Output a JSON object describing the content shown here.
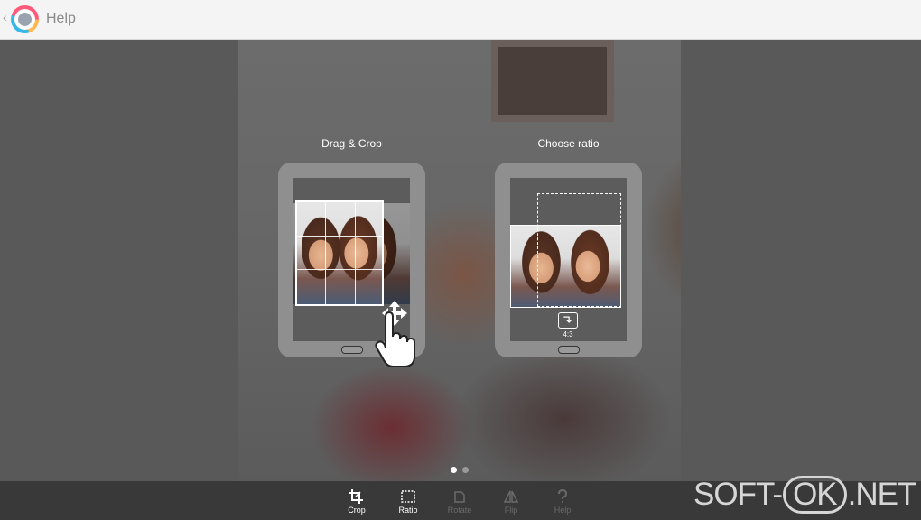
{
  "header": {
    "back_glyph": "‹",
    "title": "Help"
  },
  "slides": [
    {
      "label": "Drag & Crop"
    },
    {
      "label": "Choose ratio",
      "ratio_label": "4:3"
    }
  ],
  "pager": {
    "count": 2,
    "active_index": 0,
    "active_color": "#ffffff",
    "inactive_color": "#9a9a9a"
  },
  "toolbar": {
    "items": [
      {
        "label": "Crop",
        "icon": "crop-icon",
        "enabled": true
      },
      {
        "label": "Ratio",
        "icon": "ratio-icon",
        "enabled": true
      },
      {
        "label": "Rotate",
        "icon": "rotate-icon",
        "enabled": false
      },
      {
        "label": "Flip",
        "icon": "flip-icon",
        "enabled": false
      },
      {
        "label": "Help",
        "icon": "help-icon",
        "enabled": false
      }
    ]
  },
  "watermark": {
    "prefix": "SOFT-",
    "badge": "OK",
    "suffix": ".NET"
  }
}
